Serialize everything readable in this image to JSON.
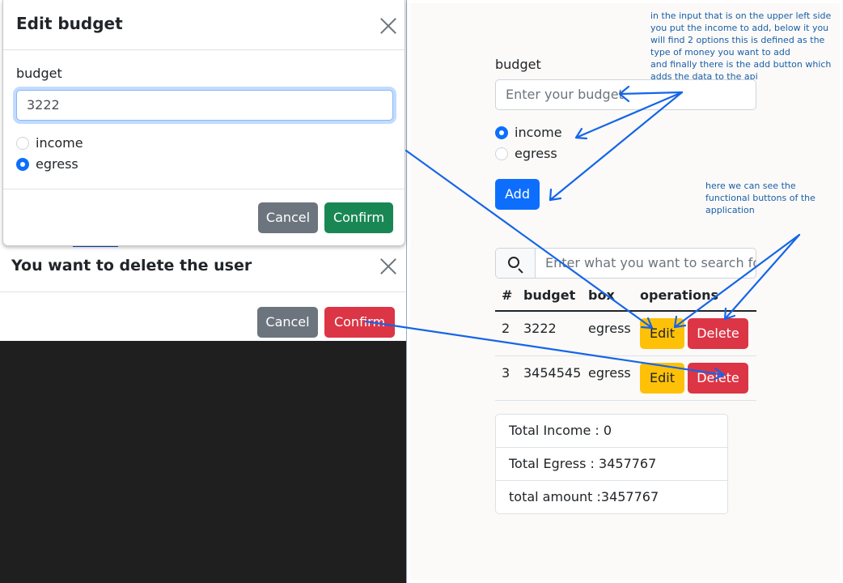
{
  "edit_modal": {
    "title": "Edit budget",
    "field_label": "budget",
    "budget_value": "3222",
    "radio_options": [
      "income",
      "egress"
    ],
    "selected": "egress",
    "cancel_label": "Cancel",
    "confirm_label": "Confirm"
  },
  "delete_modal": {
    "title": "You want to delete the user",
    "cancel_label": "Cancel",
    "confirm_label": "Confirm"
  },
  "form": {
    "label": "budget",
    "placeholder": "Enter your budget",
    "radio_options": [
      "income",
      "egress"
    ],
    "selected": "income",
    "add_label": "Add"
  },
  "search": {
    "placeholder": "Enter what you want to search for"
  },
  "table": {
    "headers": [
      "#",
      "budget",
      "box",
      "operations"
    ],
    "rows": [
      {
        "id": "2",
        "budget": "3222",
        "box": "egress",
        "edit": "Edit",
        "delete": "Delete"
      },
      {
        "id": "3",
        "budget": "3454545",
        "box": "egress",
        "edit": "Edit",
        "delete": "Delete"
      }
    ]
  },
  "totals": {
    "income": "Total Income : 0",
    "egress": "Total Egress : 3457767",
    "amount": "total amount :3457767"
  },
  "annotations": {
    "note_1": [
      "in the input that is on the upper left side",
      "you put the income to add, below it you",
      "will find 2 options this is defined as the",
      "type of money you want to add",
      "and finally there is the add button which",
      "adds the data to the api"
    ],
    "note_2": [
      "here we can see the",
      "functional buttons of the",
      "application"
    ]
  },
  "colors": {
    "primary": "#0d6efd",
    "success": "#198754",
    "secondary": "#6c757d",
    "danger": "#dc3545",
    "warning": "#ffc107",
    "annotation_arrow": "#1565e8",
    "annotation_text": "#1a5fa8"
  }
}
